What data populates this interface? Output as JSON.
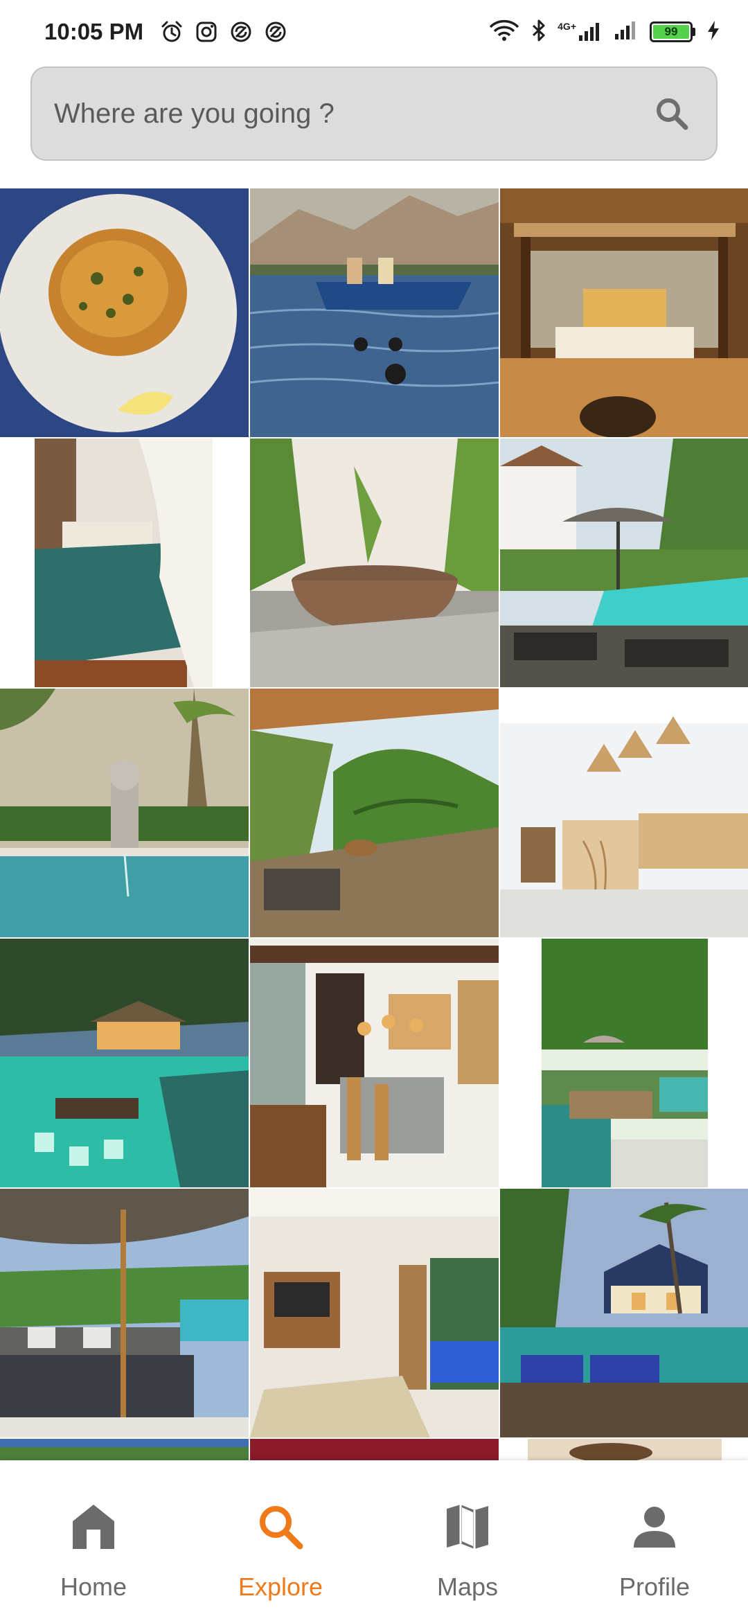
{
  "status_bar": {
    "time": "10:05 PM",
    "network_label": "4G+",
    "battery_level": "99",
    "icons": [
      "alarm-icon",
      "instagram-icon",
      "sync-icon",
      "sync-icon",
      "wifi-icon",
      "bluetooth-icon",
      "signal-icon",
      "signal-icon",
      "battery-icon",
      "charging-icon"
    ]
  },
  "search": {
    "placeholder": "Where are you going ?"
  },
  "grid": {
    "photos": [
      "food-plate-photo",
      "fishing-boat-photo",
      "bali-bedroom-photo",
      "teal-blanket-bed-photo",
      "stone-bathtub-garden-photo",
      "pool-umbrella-lounge-photo",
      "pool-statue-fountain-photo",
      "deck-palm-view-photo",
      "rattan-kitchen-photo",
      "night-pool-villa-photo",
      "modern-kitchen-dining-photo",
      "garden-pool-loungers-photo",
      "pool-daybed-umbrella-photo",
      "tv-bedroom-photo",
      "evening-pool-villa-photo",
      "partial-photo-1",
      "partial-photo-2",
      "partial-photo-3"
    ]
  },
  "colors": {
    "accent": "#f07a1a",
    "inactive": "#6b6b6b",
    "search_bg": "#dcdcdc"
  },
  "bottom_nav": {
    "items": [
      {
        "label": "Home",
        "icon": "home-icon",
        "active": false
      },
      {
        "label": "Explore",
        "icon": "search-icon",
        "active": true
      },
      {
        "label": "Maps",
        "icon": "map-icon",
        "active": false
      },
      {
        "label": "Profile",
        "icon": "person-icon",
        "active": false
      }
    ]
  }
}
